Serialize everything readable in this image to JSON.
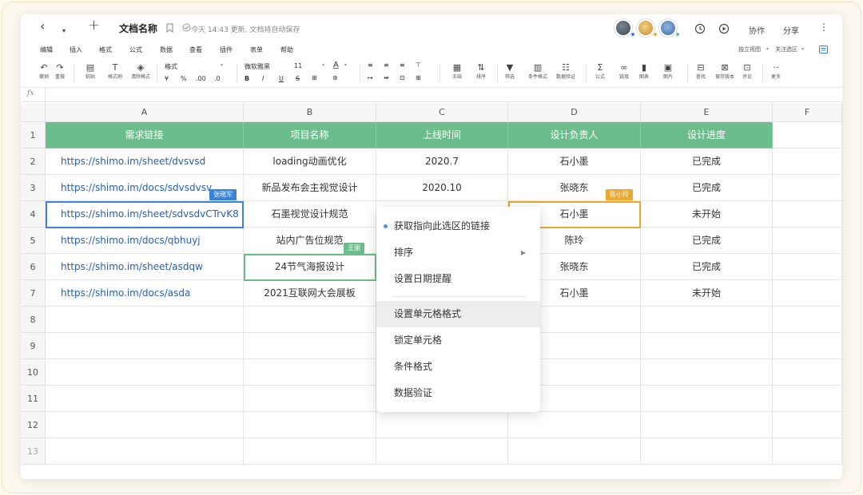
{
  "titlebar": {
    "back": "‹",
    "dropdown": "▾",
    "new": "+",
    "title": "文档名称",
    "status": "今天 14:43 更新, 文档将自动保存",
    "collab": "协作",
    "share": "分享",
    "more": "⋮"
  },
  "menu": [
    "编辑",
    "插入",
    "格式",
    "公式",
    "数据",
    "查看",
    "插件",
    "表单",
    "帮助"
  ],
  "menu_right": {
    "standalone": "独立视图",
    "follow": "关注选区"
  },
  "toolbar": {
    "undo": "撤销",
    "redo": "重做",
    "paste": "粘贴",
    "painter": "格式刷",
    "clear": "清除格式",
    "format": "格式",
    "yen": "¥",
    "percent": "%",
    "dec_less": ".00",
    "dec_more": ".0",
    "font": "微软雅黑",
    "size": "11",
    "bold": "B",
    "italic": "I",
    "underline": "U",
    "strike": "S",
    "freeze": "冻结",
    "sort": "排序",
    "filter": "筛选",
    "cond": "条件格式",
    "validate": "数据验证",
    "formula": "公式",
    "link": "链接",
    "chart": "图表",
    "image": "图片",
    "find": "查找",
    "version": "保存版本",
    "comment": "评论",
    "more": "更多"
  },
  "fx": "fx",
  "columns": [
    "A",
    "B",
    "C",
    "D",
    "E",
    "F"
  ],
  "rows": [
    "1",
    "2",
    "3",
    "4",
    "5",
    "6",
    "7",
    "8",
    "9",
    "10",
    "11",
    "12",
    "13"
  ],
  "table": {
    "header": [
      "需求链接",
      "项目名称",
      "上线时间",
      "设计负责人",
      "设计进度"
    ],
    "rows": [
      [
        "https://shimo.im/sheet/dvsvsd",
        "loading动画优化",
        "2020.7",
        "石小墨",
        "已完成"
      ],
      [
        "https://shimo.im/docs/sdvsdvsv",
        "新品发布会主视觉设计",
        "2020.10",
        "张晓东",
        "已完成"
      ],
      [
        "https://shimo.im/sheet/sdvsdvCTrvK8",
        "石墨视觉设计规范",
        "",
        "石小墨",
        "未开始"
      ],
      [
        "https://shimo.im/docs/qbhuyj",
        "站内广告位规范",
        "",
        "陈玲",
        "已完成"
      ],
      [
        "https://shimo.im/sheet/asdqw",
        "24节气海报设计",
        "",
        "张晓东",
        "已完成"
      ],
      [
        "https://shimo.im/docs/asda",
        "2021互联网大会展板",
        "",
        "石小墨",
        "未开始"
      ]
    ]
  },
  "collaborators": [
    {
      "name": "张晓军",
      "color": "#3b82d9"
    },
    {
      "name": "陈小玲",
      "color": "#e8a832"
    },
    {
      "name": "王丽",
      "color": "#6bbd8b"
    }
  ],
  "context_menu": {
    "items": [
      "获取指向此选区的链接",
      "排序",
      "设置日期提醒",
      "设置单元格格式",
      "锁定单元格",
      "条件格式",
      "数据验证"
    ],
    "submenu_arrow": "▶"
  },
  "colors": {
    "header_green": "#6bbd8b",
    "link_blue": "#2860ad",
    "accent_blue": "#3b82d9"
  }
}
